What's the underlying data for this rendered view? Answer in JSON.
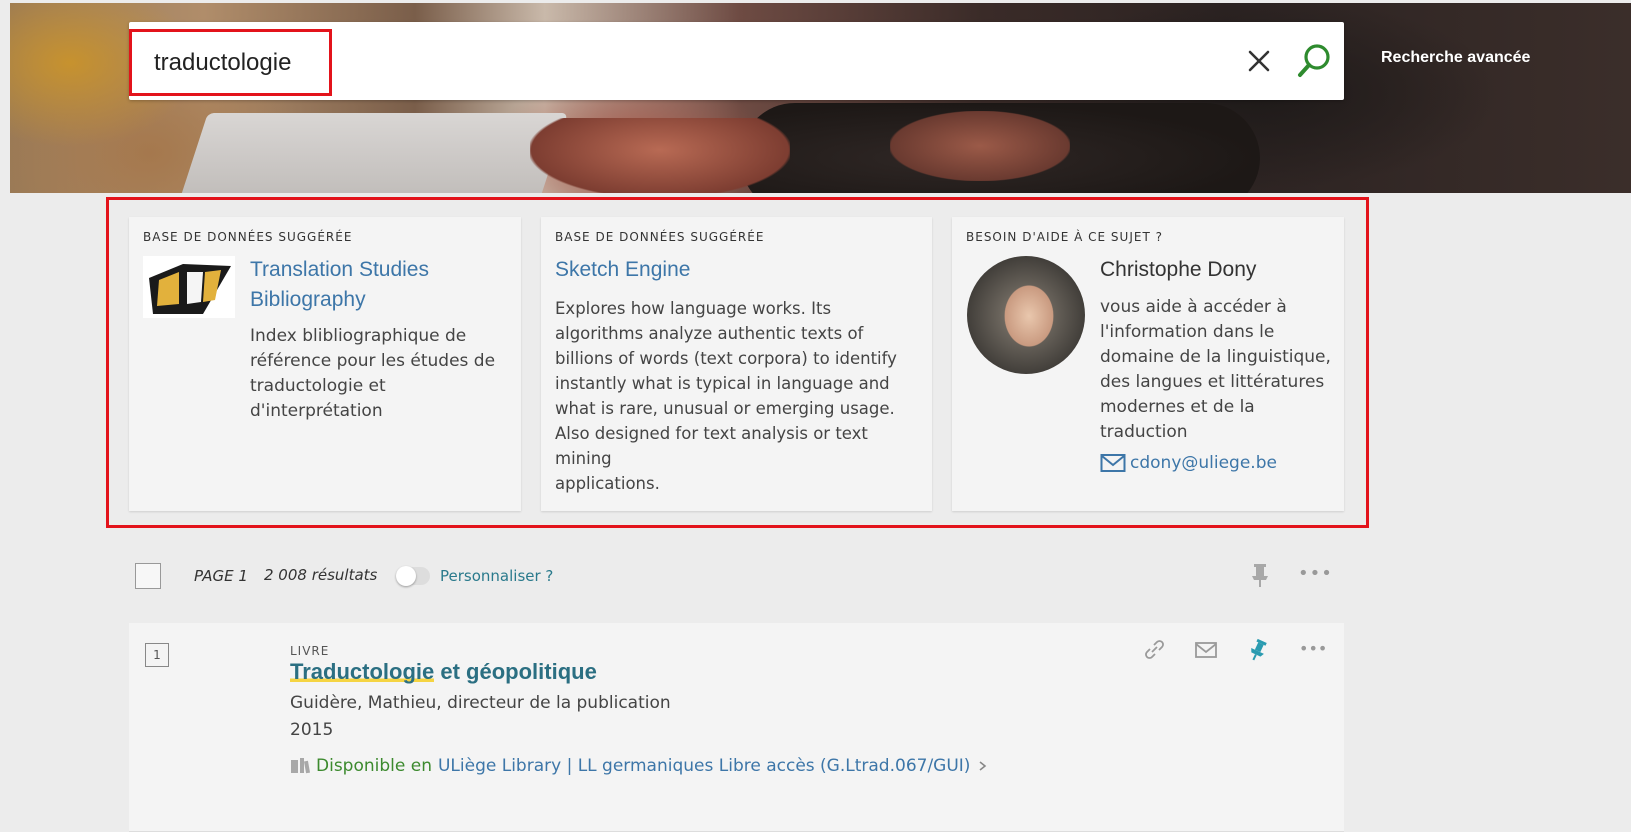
{
  "search": {
    "query": "traductologie",
    "advanced_label": "Recherche avancée"
  },
  "cards": [
    {
      "kicker": "BASE DE DONNÉES SUGGÉRÉE",
      "title": "Translation Studies Bibliography",
      "title_line1": "Translation Studies",
      "title_line2": "Bibliography",
      "desc_lines": [
        "Index blibliographique de",
        "référence pour les études de",
        "traductologie et",
        "d'interprétation"
      ]
    },
    {
      "kicker": "BASE DE DONNÉES SUGGÉRÉE",
      "title": "Sketch Engine",
      "desc_lines": [
        "Explores how language works. Its",
        "algorithms analyze authentic texts of",
        "billions of words (text corpora) to identify",
        "instantly what is typical in language and",
        "what is rare, unusual or emerging usage.",
        "Also designed for text analysis or text mining",
        "applications."
      ]
    },
    {
      "kicker": "BESOIN D'AIDE À CE SUJET ?",
      "name": "Christophe Dony",
      "desc_lines": [
        "vous aide à accéder à",
        "l'information dans le",
        "domaine de la linguistique,",
        "des langues et littératures",
        "modernes et de la",
        "traduction"
      ],
      "email": "cdony@uliege.be"
    }
  ],
  "results_bar": {
    "page_label": "PAGE 1",
    "count": "2 008 résultats",
    "personalize_label": "Personnaliser ?"
  },
  "result": {
    "index": "1",
    "type": "LIVRE",
    "title_highlight": "Traductologie",
    "title_rest": " et géopolitique",
    "author": "Guidère, Mathieu, directeur de la publication",
    "year": "2015",
    "availability_status": "Disponible en",
    "availability_location": "ULiège Library | LL germaniques  Libre accès (G.Ltrad.067/GUI)"
  },
  "colors": {
    "accent_red": "#e3131b",
    "link_blue": "#3d76a8",
    "teal": "#2b6f82",
    "green": "#3c8a2e"
  }
}
